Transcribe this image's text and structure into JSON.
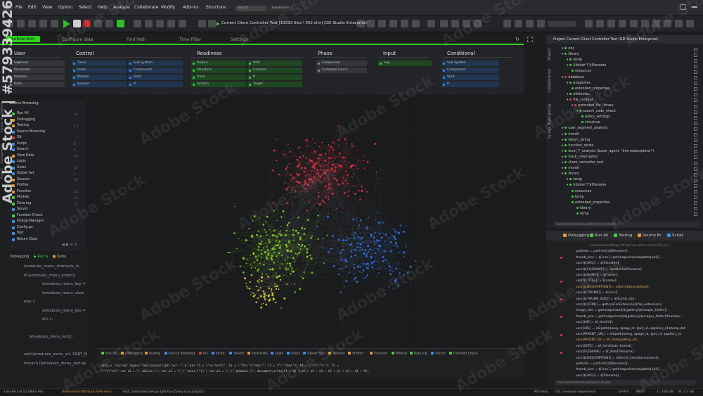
{
  "menubar": {
    "items": [
      "File",
      "Edit",
      "View",
      "Option",
      "Select",
      "Help",
      "Analyze",
      "Collaborate",
      "Modify",
      "Add-Ins",
      "Structure"
    ],
    "search": "Search",
    "extensions": "Extensions"
  },
  "toolbar": {
    "project_title": "Current Client Controller Test [10293 files \\ 502 dirs] (GD Studio Enterprise)"
  },
  "tabs": [
    "Subsection",
    "Configure data",
    "Find Path",
    "Time Filter",
    "Settings"
  ],
  "categories": [
    {
      "title": "User",
      "chips": [
        [
          "Segment",
          "gray"
        ],
        [
          "Parameter",
          "gray"
        ],
        [
          "Relation",
          "gray"
        ],
        [
          "Data",
          "gray"
        ]
      ]
    },
    {
      "title": "Control",
      "chips": [
        [
          "Timer",
          "blue"
        ],
        [
          "Index",
          "blue"
        ],
        [
          "Module",
          "blue"
        ],
        [
          "Session",
          "blue"
        ],
        [
          "Sub System",
          "blue"
        ],
        [
          "Component",
          "blue"
        ],
        [
          "Start",
          "blue"
        ],
        [
          "If",
          "blue"
        ]
      ]
    },
    {
      "title": "Readiness",
      "chips": [
        [
          "Output",
          "green"
        ],
        [
          "Structure",
          "green"
        ],
        [
          "Track",
          "green"
        ],
        [
          "Scratch",
          "green"
        ],
        [
          "Path",
          "green"
        ],
        [
          "Function",
          "green"
        ],
        [
          "If",
          "green"
        ],
        [
          "Target",
          "green"
        ]
      ]
    },
    {
      "title": "Phase",
      "chips": [
        [
          "Component",
          "gray"
        ],
        [
          "Complete Funct",
          "gray"
        ]
      ]
    },
    {
      "title": "Input",
      "chips": [
        [
          "Log",
          "green"
        ]
      ]
    },
    {
      "title": "Conditional",
      "chips": [
        [
          "Sub System",
          "blue"
        ],
        [
          "Component",
          "blue"
        ],
        [
          "Start",
          "blue"
        ],
        [
          "If",
          "blue"
        ]
      ]
    }
  ],
  "left_tabs": [
    "Syntax Highlighting",
    "Components",
    "Project"
  ],
  "explorer": {
    "header": "Source Browsing",
    "items": [
      [
        "Run All",
        "#3fd33a",
        "14"
      ],
      [
        "Debugging",
        "#e39a32",
        ""
      ],
      [
        "Testing",
        "#e39a32",
        "1 1"
      ],
      [
        "Source Browsing",
        "#3c8ff0",
        ""
      ],
      [
        "Git",
        "#c24040",
        ""
      ],
      [
        "Script",
        "#3c8ff0",
        "8"
      ],
      [
        "Search",
        "#3c8ff0",
        "1"
      ],
      [
        "View Data",
        "#e39a32",
        "12"
      ],
      [
        "Login",
        "#3c8ff0",
        ""
      ],
      [
        "Users",
        "#3c8ff0",
        "13"
      ],
      [
        "Global Set",
        "#3c8ff0",
        "1"
      ],
      [
        "Session",
        "#e39a32",
        "16"
      ],
      [
        "Profiler",
        "#e39a32",
        ""
      ],
      [
        "Function",
        "#e39a32",
        "14"
      ],
      [
        "Module",
        "#3fd33a",
        "12"
      ],
      [
        "Data log",
        "#3fd33a",
        "11"
      ],
      [
        "Server",
        "#3c8ff0",
        ""
      ],
      [
        "Function Check",
        "#3fd33a",
        ""
      ],
      [
        "Debug Manager",
        "#3c8ff0",
        ""
      ],
      [
        "Config.px",
        "#3c8ff0",
        ""
      ],
      [
        "Test",
        "#3c8ff0",
        ""
      ],
      [
        "Return Data",
        "#3c8ff0",
        ""
      ]
    ],
    "mini_tabs": [
      "Debugging",
      "Run A",
      "Debu"
    ]
  },
  "left_code": [
    "$modules_menu_shortcuts_lo",
    "if ($modules_menu_shortcu",
    "$modules_menu_key =",
    "$modules_menu_class",
    "else {",
    "$modules_menu_key =",
    "$i++;",
    "",
    "$modules_menu_sort[]",
    "",
    "sort($modules_menu_srt, SORT_N",
    "foreach ($modules_menu_sort as"
  ],
  "console": {
    "tabs": [
      [
        "Run All",
        "#3fd33a"
      ],
      [
        "Debugging",
        "#e39a32"
      ],
      [
        "Testing",
        "#e39a32"
      ],
      [
        "Source Browsing",
        "#3c8ff0"
      ],
      [
        "Git",
        "#c24040"
      ],
      [
        "Script",
        "#3c8ff0"
      ],
      [
        "Search",
        "#3c8ff0"
      ],
      [
        "View Data",
        "#e39a32"
      ],
      [
        "Login",
        "#3c8ff0"
      ],
      [
        "Users",
        "#3c8ff0"
      ],
      [
        "Global Set",
        "#3c8ff0"
      ],
      [
        "Session",
        "#e39a32"
      ],
      [
        "Profiler",
        "#e39a32"
      ],
      [
        "Function",
        "#e39a32"
      ],
      [
        "Module",
        "#3fd33a"
      ],
      [
        "Data log",
        "#3fd33a"
      ],
      [
        "Server",
        "#3c8ff0"
      ],
      [
        "Function Check",
        "#3fd33a"
      ]
    ],
    "lines": [
      "$ret = \"<script type=\\\"text/javascript\\\"><!--\".$.\"var t1 = \\\"<a href\\\"; t2 = \\\"?f=\\\"(\\\"mai\\\"; t3 = \\\"(\\\"dim\\\"); t4 = \\\"\\\"(\\\"!\\\"); t5 = ",
      "\\\"^(\\\"el\\\" var a1 = \\\".$alias.\\\"; var a2 = \\\".\\\".$ext.\\\"(\\\"; var a3 = \\\".\\\".$domain.\\\"; document.write(t1 + t2 + a1 + a2 + a3 + t4 + a1 + a2 + a3 + t5)"
    ]
  },
  "right_panel": {
    "title": "Project Current Client Controller Test (GD Studio Enterprise)",
    "vtabs": [
      "Project",
      "Collaboration",
      "Syntax Highlighting"
    ],
    "tree": [
      [
        0,
        "v",
        "#3fd33a",
        "doc"
      ],
      [
        0,
        "v",
        "#3fd33a",
        "library"
      ],
      [
        1,
        "v",
        "#3fd33a",
        "temp"
      ],
      [
        1,
        "v",
        "#3fd33a",
        "$folder\"/\"$filename"
      ],
      [
        2,
        "",
        "#3fd33a",
        "resources"
      ],
      [
        0,
        "v",
        "#e04040",
        "database"
      ],
      [
        1,
        "v",
        "#3fd33a",
        "properties"
      ],
      [
        2,
        "",
        "#3fd33a",
        "extended_properties"
      ],
      [
        1,
        "v",
        "#3fd33a",
        "attributes"
      ],
      [
        1,
        "v",
        "#e04040",
        "file_content"
      ],
      [
        2,
        "v",
        "#e04040",
        "extended_file_library"
      ],
      [
        3,
        "v",
        "#3fd33a",
        "search_code_check"
      ],
      [
        4,
        "",
        "#3fd33a",
        "policy_settings"
      ],
      [
        4,
        "",
        "#3fd33a",
        "structure"
      ],
      [
        0,
        ">",
        "#3fd33a",
        "user_segment_analysis"
      ],
      [
        0,
        ">",
        "#3fd33a",
        "month"
      ],
      [
        0,
        ">",
        "#3fd33a",
        "return_string"
      ],
      [
        0,
        ">",
        "#3fd33a",
        "function_exists"
      ],
      [
        0,
        ">",
        "#3fd33a",
        "level_7_analysis ($user_agent, \"$im-webexplorer\")"
      ],
      [
        0,
        ">",
        "#3fd33a",
        "track_interrupted"
      ],
      [
        0,
        ">",
        "#3fd33a",
        "client_controller_test"
      ],
      [
        0,
        ">",
        "#3fd33a",
        "month"
      ],
      [
        0,
        "v",
        "#3fd33a",
        "library"
      ],
      [
        1,
        "v",
        "#3fd33a",
        "temp"
      ],
      [
        1,
        "v",
        "#3fd33a",
        "$folder\"/\"$filename"
      ],
      [
        2,
        "",
        "#3fd33a",
        "resources"
      ],
      [
        2,
        "",
        "#3fd33a",
        "temp"
      ],
      [
        2,
        "",
        "#3fd33a",
        "extended_properties"
      ],
      [
        3,
        "",
        "#3fd33a",
        "library"
      ],
      [
        3,
        "",
        "#3fd33a",
        "temp"
      ]
    ],
    "footer": "doc/client/controller.px/library/test.json/td"
  },
  "debug_panel": {
    "tabs": [
      [
        "Debugging",
        "#e39a32"
      ],
      [
        "Run All",
        "#3fd33a"
      ],
      [
        "Testing",
        "#3fd33a"
      ],
      [
        "Source Br",
        "#e39a32"
      ],
      [
        "Script",
        "#3c8ff0"
      ]
    ],
    "lines": [
      "$downloadsettings string func.php.nav(config.list ...",
      "pathinfo = pathinfo($[filename]);",
      "thumb_size = $[icon] / getimagesize(realpath($[url]), ...",
      "vars[$[URL]] = $[filename];",
      "vars[$[FILENAME]] = $pathinfo[filename];",
      "vars[$[NAME]] = $[name];",
      "vars[$[TITLE]] = $[name];",
      "vars[$[DESCRIPTION]] = nl2br($[description]);",
      "vars[$[THUMB]] = $[icon];",
      "vars[$[THUMB_SIZE]] = $thumb_size;",
      "vars[$[ICON]] = getIconForExtension($file_extension);",
      "image_size = getimagesize($[$[gallery]/$images_folder]/...",
      "thumb_size = getimagesize($[$[gallery]/$images_folder]/thumbs/...",
      "vars[$ID] = $f_item[id];",
      "vars[URL] = id2path($long, $page_id, $pid_id=$gallery_id.$temp.dat",
      "vars[PARENT_URL] = id2path($long, $page_id, $pid_id, $gallery_id.",
      "vars[PARENT_ID] = $f_item[gallery_id];",
      "vars[DATE] = $f_item[date_format];",
      "vars[FILENAME] = $f_item[filename];",
      "vars[$[DESCRIPTION]] = nl2br($f_item[description]);",
      "pathinfo = pathinfo($[filename]);",
      "thumb_size = $[icon] / getimagesize(realpath($[url]), ...",
      "vars[$[URL]] = $[filename];"
    ],
    "footer": "doc/client/controller.px/phpe/rule.json"
  },
  "status": {
    "left": "Line 89 Col 12 (Main.PH)",
    "warning": "Unresolved Attribute Reference",
    "file": "test_clientcontroller.px (gfx/hp-25/shy (run_July25))",
    "ready": "Kit ready",
    "git": "Git: checkout experiment",
    "gpu": "GHT-8",
    "mem1": "MR07",
    "disk": "C: 180 GB",
    "ram": "M: 2.7 GB"
  },
  "watermark_text": "Adobe Stock",
  "side_id": "Adobe Stock | #579339426",
  "chart_data": {
    "type": "network",
    "clusters": [
      {
        "name": "",
        "color": "#e0303d",
        "nodes": 420
      },
      {
        "name": "",
        "color": "#7ed321",
        "nodes": 380
      },
      {
        "name": "",
        "color": "#2f6fe0",
        "nodes": 360
      },
      {
        "name": "",
        "color": "#d8d33a",
        "nodes": 120
      }
    ]
  }
}
